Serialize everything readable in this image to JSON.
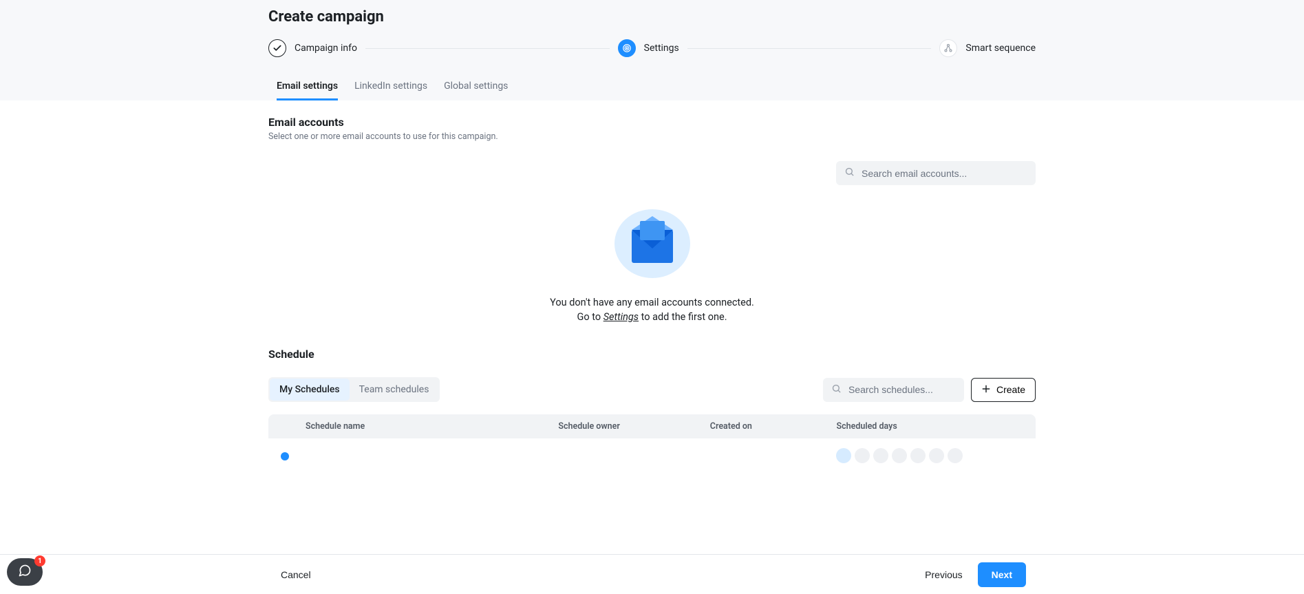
{
  "header": {
    "title": "Create campaign"
  },
  "stepper": {
    "step1": "Campaign info",
    "step2": "Settings",
    "step3": "Smart sequence"
  },
  "tabs": {
    "email": "Email settings",
    "linkedin": "LinkedIn settings",
    "global": "Global settings"
  },
  "email": {
    "title": "Email accounts",
    "subtitle": "Select one or more email accounts to use for this campaign.",
    "search_placeholder": "Search email accounts...",
    "empty_line1": "You don't have any email accounts connected.",
    "empty_pre": "Go to ",
    "empty_link": "Settings",
    "empty_post": " to add the first one."
  },
  "schedule": {
    "title": "Schedule",
    "my": "My Schedules",
    "team": "Team schedules",
    "search_placeholder": "Search schedules...",
    "create": "Create",
    "cols": {
      "name": "Schedule name",
      "owner": "Schedule owner",
      "created": "Created on",
      "days": "Scheduled days"
    }
  },
  "footer": {
    "cancel": "Cancel",
    "previous": "Previous",
    "next": "Next"
  },
  "chat": {
    "badge": "1"
  }
}
